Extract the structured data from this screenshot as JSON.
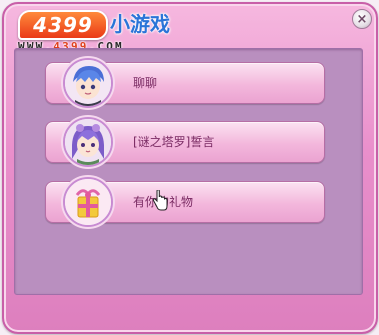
{
  "brand": {
    "badge": "4399",
    "name": "小游戏",
    "url_prefix": "WWW.",
    "url_highlight": "4399",
    "url_suffix": ".COM"
  },
  "close_label": "×",
  "options": [
    {
      "label": "聊聊",
      "avatar_icon": "blue-hair-boy-icon"
    },
    {
      "label": "[谜之塔罗]誓言",
      "avatar_icon": "purple-hair-girl-icon"
    },
    {
      "label": "有你的礼物",
      "avatar_icon": "gift-box-icon"
    }
  ],
  "colors": {
    "dialog_bg": "#e98fcb",
    "panel_bg": "#b98fbf",
    "option_text": "#7a2b63",
    "brand_orange": "#ea3a17",
    "brand_blue": "#2b74d8"
  }
}
